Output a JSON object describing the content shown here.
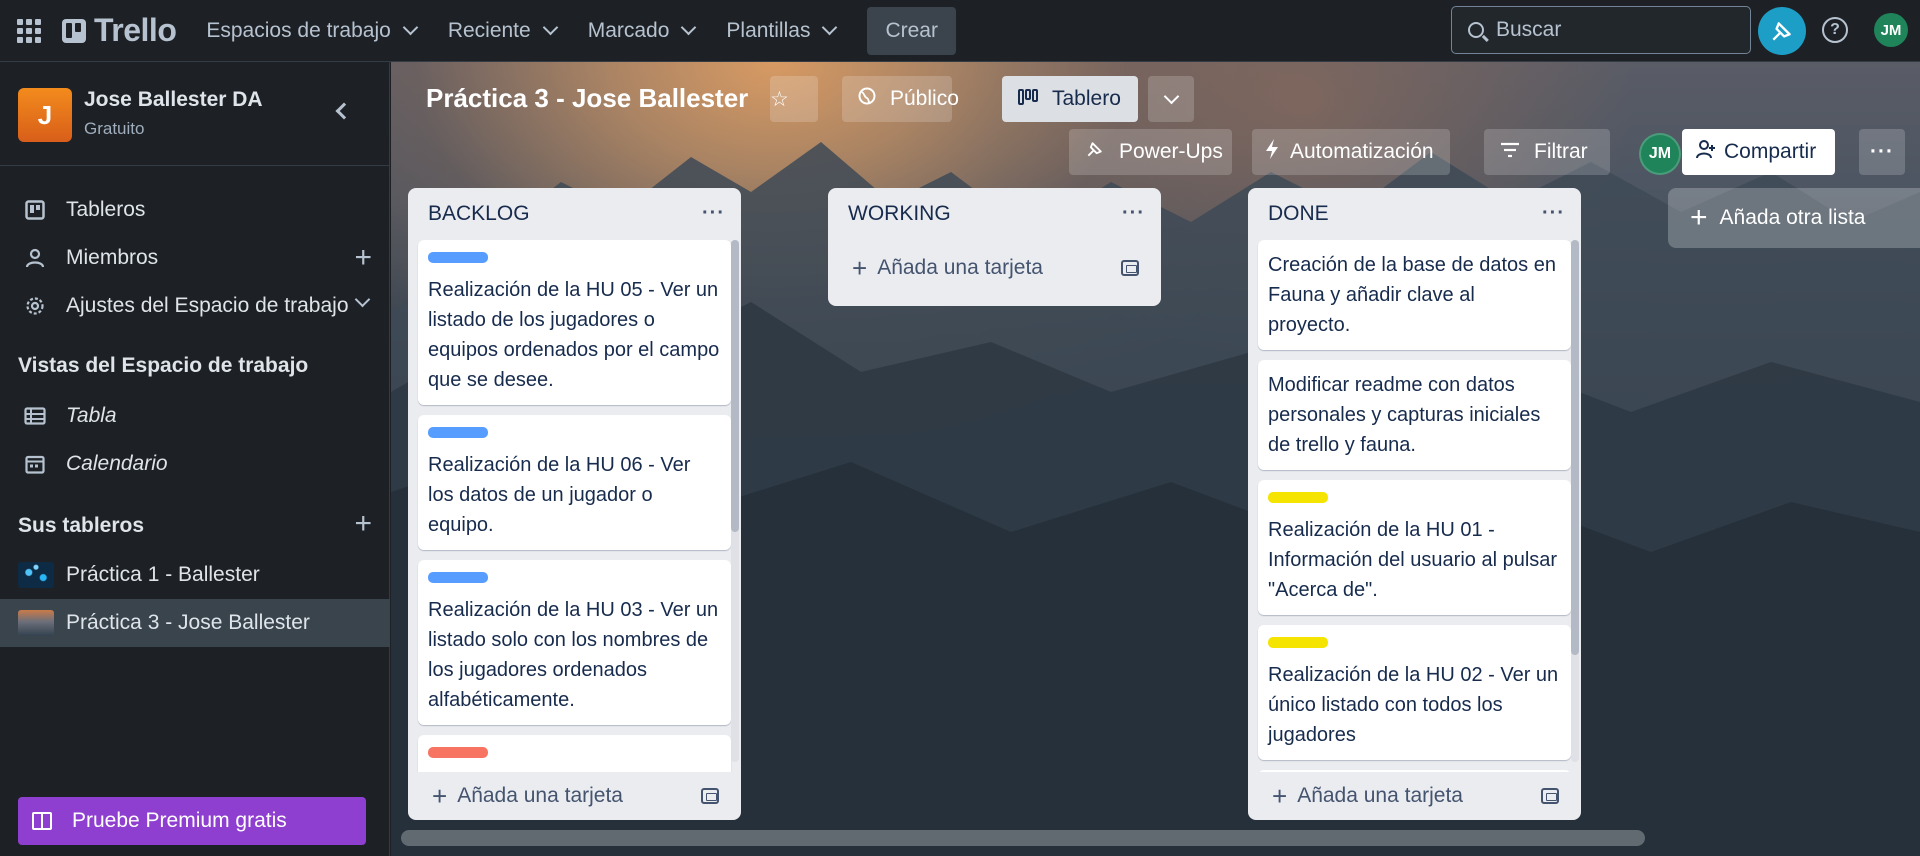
{
  "topbar": {
    "brand": "Trello",
    "nav": [
      "Espacios de trabajo",
      "Reciente",
      "Marcado",
      "Plantillas"
    ],
    "create": "Crear",
    "search_placeholder": "Buscar",
    "avatar": "JM"
  },
  "sidebar": {
    "workspace_initial": "J",
    "workspace_name": "Jose Ballester DA",
    "workspace_plan": "Gratuito",
    "items": [
      {
        "label": "Tableros"
      },
      {
        "label": "Miembros"
      },
      {
        "label": "Ajustes del Espacio de trabajo"
      }
    ],
    "views_heading": "Vistas del Espacio de trabajo",
    "views": [
      {
        "label": "Tabla"
      },
      {
        "label": "Calendario"
      }
    ],
    "boards_heading": "Sus tableros",
    "boards": [
      {
        "label": "Práctica 1 - Ballester"
      },
      {
        "label": "Práctica 3 - Jose Ballester"
      }
    ],
    "premium": "Pruebe Premium gratis"
  },
  "board": {
    "title": "Práctica 3 - Jose Ballester",
    "visibility": "Público",
    "view": "Tablero",
    "powerups": "Power-Ups",
    "automation": "Automatización",
    "filter": "Filtrar",
    "member": "JM",
    "share": "Compartir",
    "add_list": "Añada otra lista",
    "add_card": "Añada una tarjeta"
  },
  "lists": [
    {
      "title": "BACKLOG",
      "cards": [
        {
          "label_color": "#579dff",
          "text": "Realización de la HU 05 - Ver un listado de los jugadores o equipos ordenados por el campo que se desee."
        },
        {
          "label_color": "#579dff",
          "text": "Realización de la HU 06 - Ver los datos de un jugador o equipo."
        },
        {
          "label_color": "#579dff",
          "text": "Realización de la HU 03 - Ver un listado solo con los nombres de los jugadores ordenados alfabéticamente."
        },
        {
          "label_color": "#f87462",
          "text": ""
        }
      ]
    },
    {
      "title": "WORKING",
      "cards": []
    },
    {
      "title": "DONE",
      "cards": [
        {
          "label_color": "",
          "text": "Creación de la base de datos en Fauna y añadir clave al proyecto."
        },
        {
          "label_color": "",
          "text": "Modificar readme con datos personales y capturas iniciales de trello y fauna."
        },
        {
          "label_color": "#f5e400",
          "text": "Realización de la HU 01 - Información del usuario al pulsar \"Acerca de\"."
        },
        {
          "label_color": "#f5e400",
          "text": "Realización de la HU 02 - Ver un único listado con todos los jugadores"
        },
        {
          "label_color": "#f5e400",
          "text": ""
        }
      ]
    }
  ]
}
